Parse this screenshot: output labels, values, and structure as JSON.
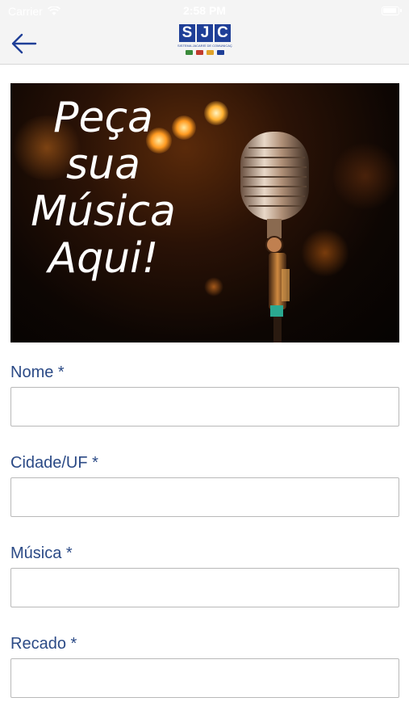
{
  "status_bar": {
    "carrier": "Carrier",
    "time": "2:58 PM"
  },
  "header": {
    "logo": {
      "letters": [
        "S",
        "J",
        "C"
      ],
      "tagline": "SISTEMA JACAREÍ DE COMUNICAÇÃO",
      "brand_color": "#1f3f97"
    }
  },
  "banner": {
    "lines": [
      "Peça",
      "sua",
      "Música",
      "Aqui!"
    ]
  },
  "form": {
    "label_color": "#2b4a86",
    "fields": [
      {
        "label": "Nome *",
        "value": "",
        "placeholder": ""
      },
      {
        "label": "Cidade/UF *",
        "value": "",
        "placeholder": ""
      },
      {
        "label": "Música *",
        "value": "",
        "placeholder": ""
      },
      {
        "label": "Recado *",
        "value": "",
        "placeholder": ""
      }
    ]
  },
  "icons": {
    "back": "arrow-left-icon",
    "wifi": "wifi-icon",
    "battery": "battery-icon"
  }
}
